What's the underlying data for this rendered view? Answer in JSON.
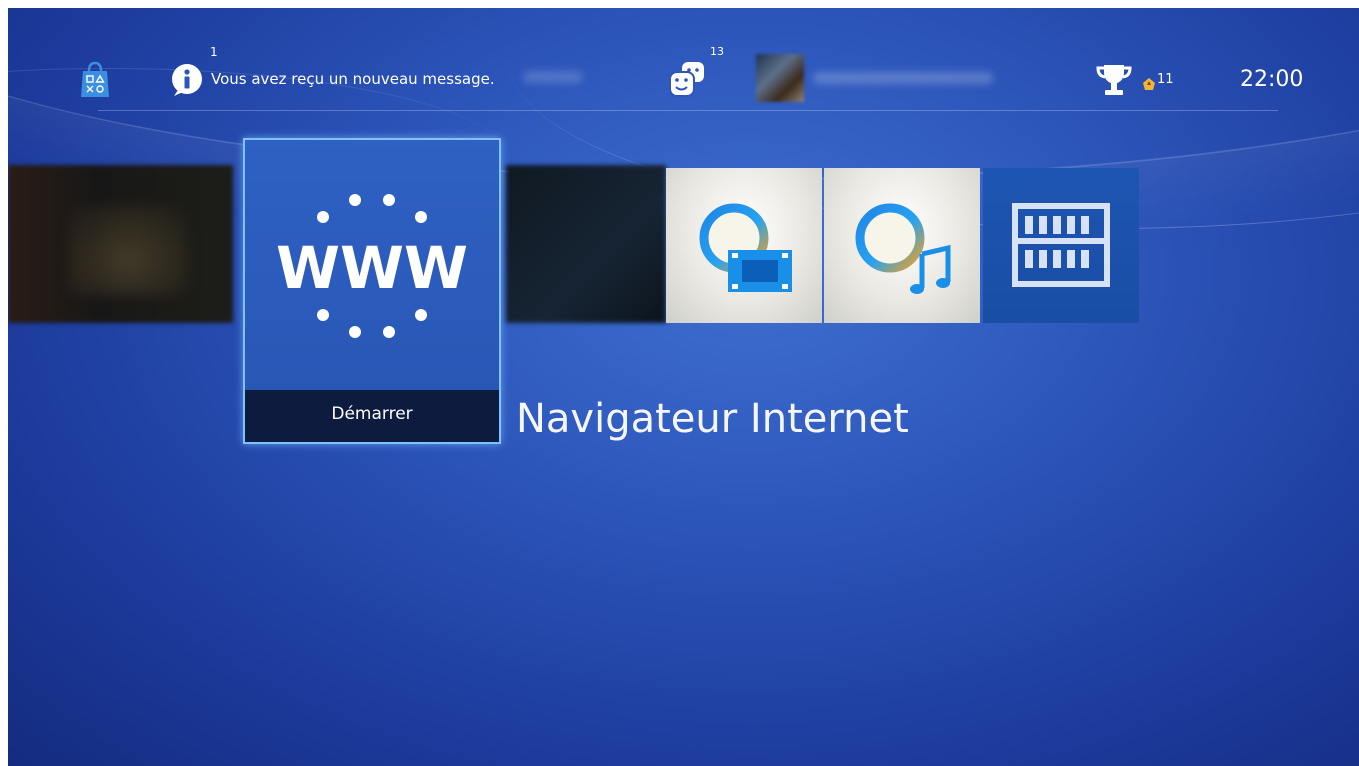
{
  "status_bar": {
    "notification": {
      "count": "1",
      "message": "Vous avez reçu un nouveau message."
    },
    "friends": {
      "count": "13"
    },
    "trophies": {
      "level": "11"
    },
    "clock": "22:00"
  },
  "selected_tile": {
    "icon_text": "WWW",
    "action_label": "Démarrer",
    "title": "Navigateur Internet"
  },
  "colors": {
    "background": "#2d56bb",
    "selection_border": "#7ec3ff",
    "label_bar": "#0c1b3e",
    "library_tile": "#1d55b3"
  },
  "icons": {
    "store": "playstation-store-icon",
    "notifications": "info-icon",
    "friends": "friends-icon",
    "trophies": "trophy-icon",
    "browser": "www-icon",
    "video": "video-unlimited-icon",
    "music": "music-unlimited-icon",
    "library": "library-icon"
  }
}
